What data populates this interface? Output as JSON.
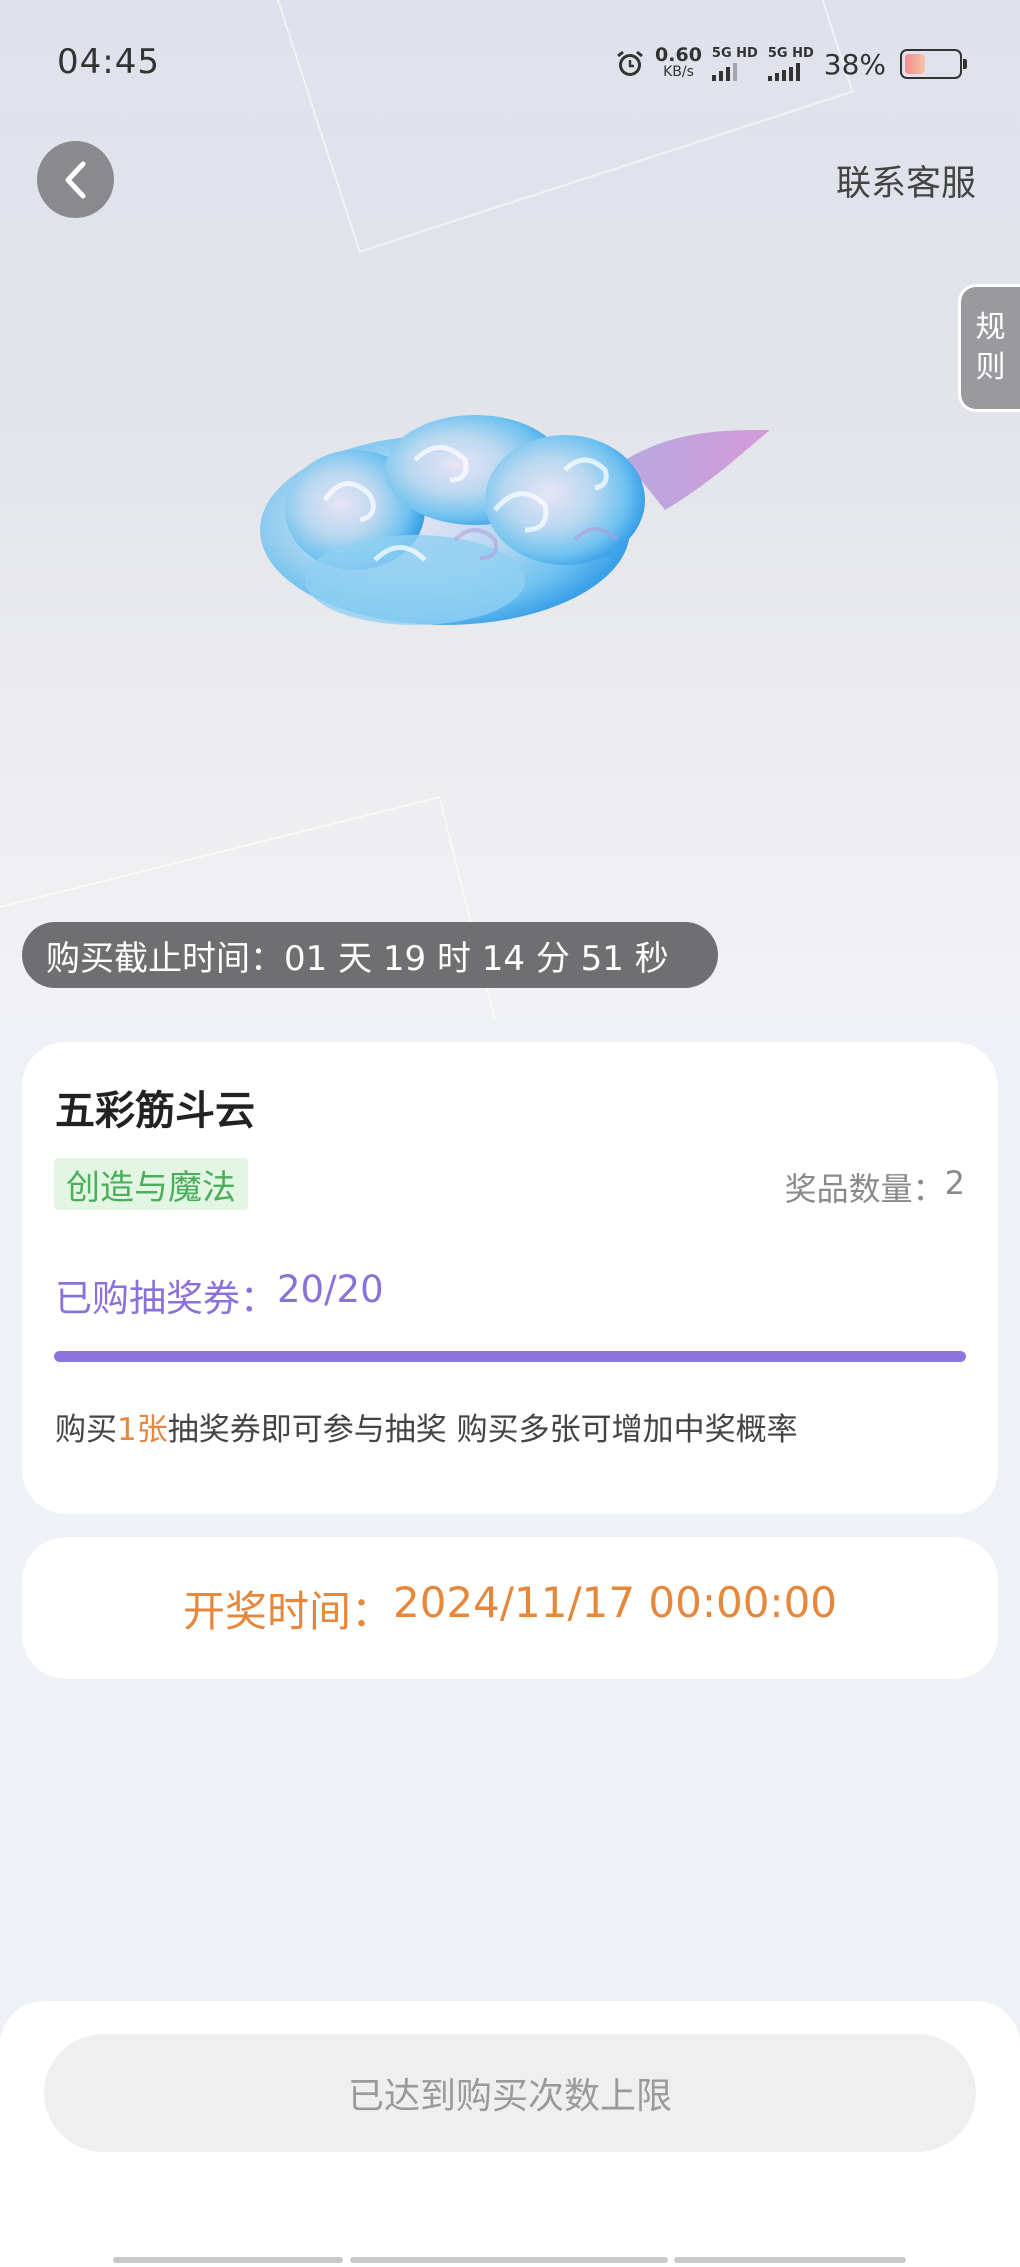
{
  "status_bar": {
    "time": "04:45",
    "net_speed_value": "0.60",
    "net_speed_unit": "KB/s",
    "sim1_label": "5G HD",
    "sim2_label": "5G HD",
    "battery_percent_text": "38%",
    "battery_level": 0.38,
    "icons": [
      "alarm-icon",
      "signal-icon",
      "signal-icon",
      "battery-icon"
    ]
  },
  "header": {
    "back_icon": "chevron-left-icon",
    "support_label": "联系客服",
    "rules_chars": [
      "规",
      "则"
    ]
  },
  "hero": {
    "image": "somersault-cloud-image",
    "deadline_label": "购买截止时间：",
    "deadline_value": "01 天 19 时 14 分 51 秒"
  },
  "item": {
    "name": "五彩筋斗云",
    "category": "创造与魔法",
    "prize_count_label": "奖品数量：",
    "prize_count_value": "2",
    "tickets_label": "已购抽奖券：",
    "tickets_value": "20/20",
    "tickets_progress": 1.0,
    "hint_pre": "购买",
    "hint_highlight": "1张",
    "hint_post": "抽奖券即可参与抽奖 购买多张可增加中奖概率"
  },
  "draw": {
    "label": "开奖时间：",
    "value": "2024/11/17 00:00:00"
  },
  "footer": {
    "limit_button_label": "已达到购买次数上限"
  },
  "colors": {
    "accent_purple": "#8c74de",
    "accent_orange": "#e6883c",
    "tag_green": "#4cae5c",
    "tag_green_bg": "#e3f5e3"
  }
}
